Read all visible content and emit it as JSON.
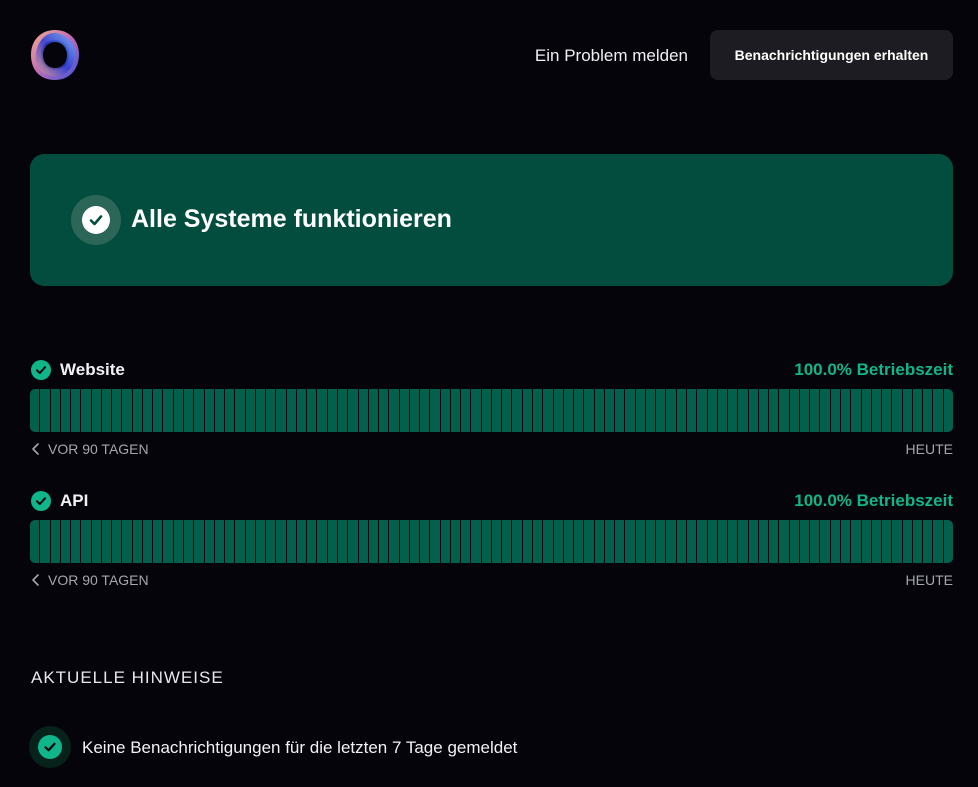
{
  "header": {
    "logo_icon": "abstract-ring-logo",
    "report_link": "Ein Problem melden",
    "notify_button": "Benachrichtigungen erhalten"
  },
  "banner": {
    "title": "Alle Systeme funktionieren",
    "icon": "check-circle-icon",
    "background": "#024d3e"
  },
  "components": [
    {
      "name": "Website",
      "uptime": "100.0% Betriebszeit",
      "status_icon": "check-circle-icon",
      "range_start": "VOR 90 TAGEN",
      "range_end": "HEUTE",
      "day_count": 90,
      "day_status": "operational"
    },
    {
      "name": "API",
      "uptime": "100.0% Betriebszeit",
      "status_icon": "check-circle-icon",
      "range_start": "VOR 90 TAGEN",
      "range_end": "HEUTE",
      "day_count": 90,
      "day_status": "operational"
    }
  ],
  "notices": {
    "title": "AKTUELLE HINWEISE",
    "items": [
      {
        "text": "Keine Benachrichtigungen für die letzten 7 Tage gemeldet",
        "icon": "check-circle-icon"
      }
    ]
  },
  "colors": {
    "background": "#04040a",
    "accent": "#12b58a",
    "bar": "#02604d",
    "button": "#1c1c22"
  }
}
